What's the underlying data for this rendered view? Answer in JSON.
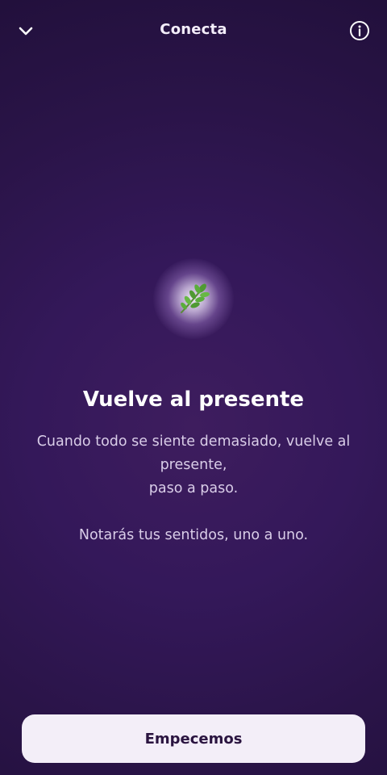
{
  "header": {
    "title": "Conecta",
    "back_icon": "chevron-down-icon",
    "info_icon": "info-circle-icon"
  },
  "hero": {
    "icon": "herb-leaf-icon",
    "glow_color": "#ffffff"
  },
  "content": {
    "headline": "Vuelve al presente",
    "line1": "Cuando todo se siente demasiado, vuelve al presente,",
    "line2": "paso a paso.",
    "line3": "Notarás tus sentidos, uno a uno."
  },
  "cta": {
    "label": "Empecemos"
  },
  "colors": {
    "background": "#34185a",
    "button_bg": "#f3eef8",
    "button_text": "#2a1440",
    "body_text": "#d9cde8"
  }
}
